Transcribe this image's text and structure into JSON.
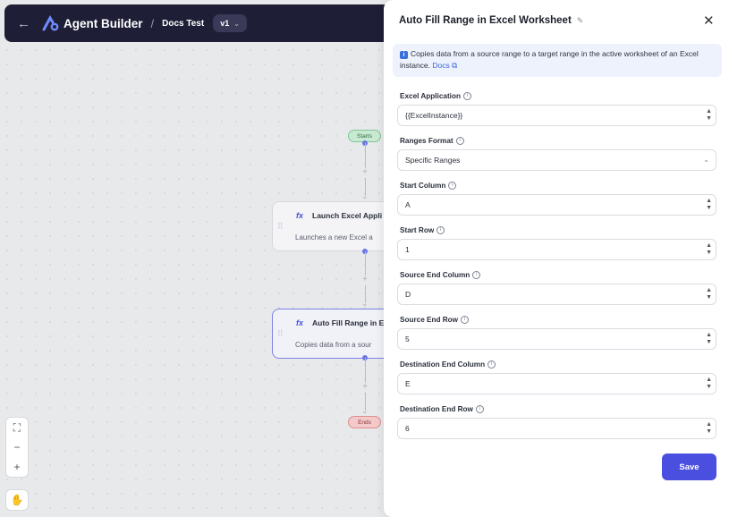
{
  "header": {
    "app_name": "Agent Builder",
    "separator": "/",
    "doc_name": "Docs Test",
    "version": "v1"
  },
  "flow": {
    "start_label": "Starts",
    "end_label": "Ends",
    "nodes": [
      {
        "title": "Launch Excel Appli",
        "desc": "Launches a new Excel a"
      },
      {
        "title": "Auto Fill Range in E",
        "desc": "Copies data from a sour"
      }
    ]
  },
  "panel": {
    "title": "Auto Fill Range in Excel Worksheet",
    "info_text": "Copies data from a source range to a target range in the active worksheet of an Excel instance.",
    "docs_link": "Docs",
    "fields": [
      {
        "label": "Excel Application",
        "value": "{{ExcelInstance}}",
        "type": "number"
      },
      {
        "label": "Ranges Format",
        "value": "Specific Ranges",
        "type": "select"
      },
      {
        "label": "Start Column",
        "value": "A",
        "type": "number"
      },
      {
        "label": "Start Row",
        "value": "1",
        "type": "number"
      },
      {
        "label": "Source End Column",
        "value": "D",
        "type": "number"
      },
      {
        "label": "Source End Row",
        "value": "5",
        "type": "number"
      },
      {
        "label": "Destination End Column",
        "value": "E",
        "type": "number"
      },
      {
        "label": "Destination End Row",
        "value": "6",
        "type": "number"
      }
    ],
    "save_label": "Save"
  },
  "colors": {
    "header_bg": "#1e1e36",
    "accent": "#4b4fe0",
    "start_green": "#c9ead2",
    "end_red": "#f3c9c9"
  }
}
